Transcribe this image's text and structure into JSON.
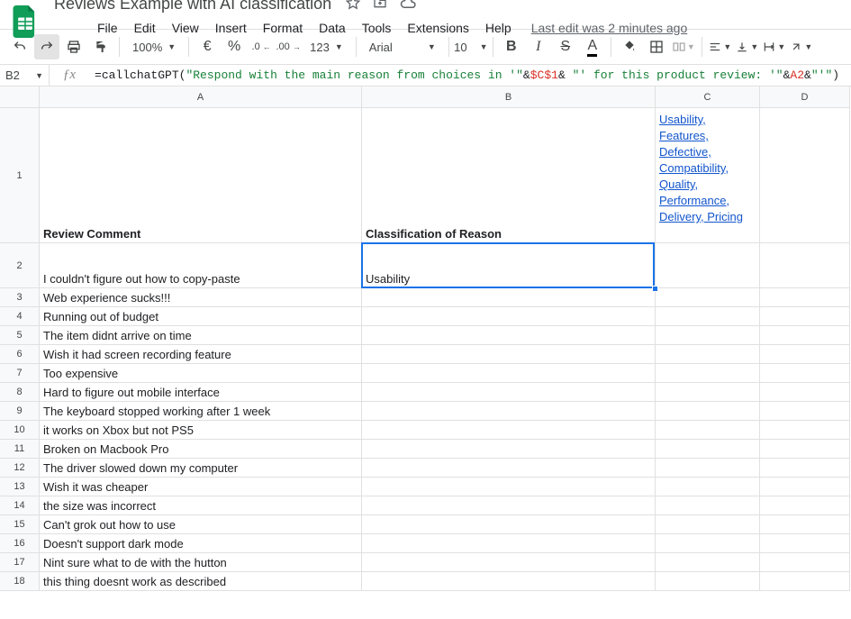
{
  "doc": {
    "title": "Reviews Example with AI classification"
  },
  "menu": {
    "file": "File",
    "edit": "Edit",
    "view": "View",
    "insert": "Insert",
    "format": "Format",
    "data": "Data",
    "tools": "Tools",
    "extensions": "Extensions",
    "help": "Help",
    "last_edit": "Last edit was 2 minutes ago"
  },
  "toolbar": {
    "zoom": "100%",
    "currency": "€",
    "percent": "%",
    "dec_dec": ".0",
    "inc_dec": ".00",
    "more_fmt": "123",
    "font": "Arial",
    "size": "10"
  },
  "namebox": "B2",
  "formula": {
    "eq": "=",
    "fn": "callchatGPT",
    "open": "(",
    "s1": "\"Respond with the main reason from choices in '\"",
    "amp1": "&",
    "r1": "$C$1",
    "amp2": "&",
    "s2": " \"' for this product review: '\"",
    "amp3": "&",
    "r2": "A2",
    "amp4": "&",
    "s3": "\"'\"",
    "close": ")"
  },
  "columns": [
    "A",
    "B",
    "C",
    "D"
  ],
  "header_row": {
    "A": "Review Comment",
    "B": "Classification of Reason",
    "C": "Usability, Features, Defective, Compatibility, Quality, Performance, Delivery, Pricing",
    "D": ""
  },
  "rows": [
    {
      "n": "2",
      "A": "I couldn't figure out how to copy-paste",
      "B": "Usability"
    },
    {
      "n": "3",
      "A": "Web experience sucks!!!",
      "B": ""
    },
    {
      "n": "4",
      "A": "Running out of budget",
      "B": ""
    },
    {
      "n": "5",
      "A": "The item didnt arrive on time",
      "B": ""
    },
    {
      "n": "6",
      "A": "Wish it had screen recording feature",
      "B": ""
    },
    {
      "n": "7",
      "A": "Too expensive",
      "B": ""
    },
    {
      "n": "8",
      "A": "Hard to figure out mobile interface",
      "B": ""
    },
    {
      "n": "9",
      "A": "The keyboard stopped working after 1 week",
      "B": ""
    },
    {
      "n": "10",
      "A": "it works on Xbox but not PS5",
      "B": ""
    },
    {
      "n": "11",
      "A": "Broken on Macbook Pro",
      "B": ""
    },
    {
      "n": "12",
      "A": "The driver slowed down my computer",
      "B": ""
    },
    {
      "n": "13",
      "A": "Wish it was cheaper",
      "B": ""
    },
    {
      "n": "14",
      "A": "the size was incorrect",
      "B": ""
    },
    {
      "n": "15",
      "A": "Can't grok out how to use",
      "B": ""
    },
    {
      "n": "16",
      "A": "Doesn't support dark mode",
      "B": ""
    },
    {
      "n": "17",
      "A": "Nint sure what to de with the hutton",
      "B": ""
    },
    {
      "n": "18",
      "A": "this thing doesnt work as described",
      "B": ""
    }
  ]
}
